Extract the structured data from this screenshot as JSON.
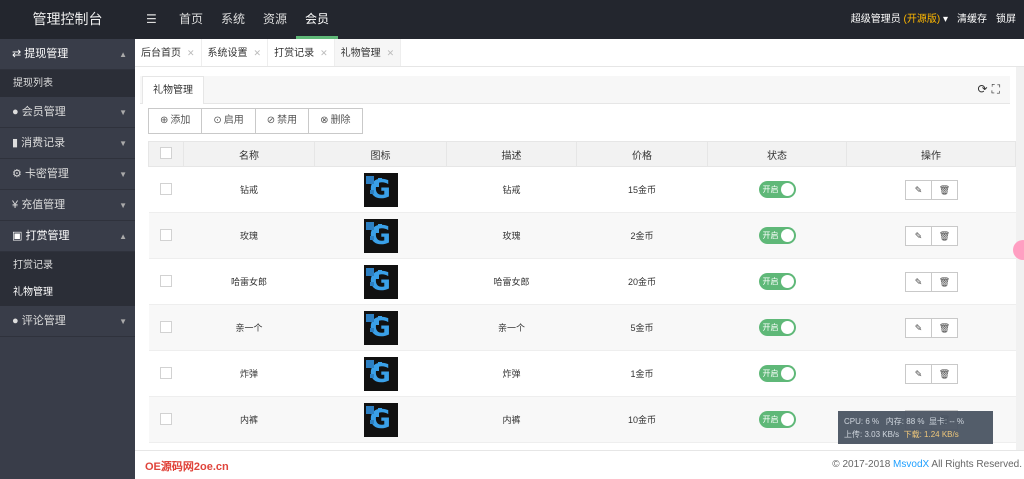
{
  "app": {
    "title": "管理控制台"
  },
  "topnav": {
    "items": [
      "首页",
      "系统",
      "资源",
      "会员"
    ],
    "active_index": 3
  },
  "topright": {
    "user": "超级管理员",
    "edition": "(开源版)",
    "clear_cache": "清缓存",
    "lock": "锁屏"
  },
  "sidebar": {
    "groups": [
      {
        "label": "提现管理",
        "icon": "exchange-icon",
        "open": true,
        "items": [
          "提现列表"
        ]
      },
      {
        "label": "会员管理",
        "icon": "user-icon",
        "open": false,
        "items": []
      },
      {
        "label": "消费记录",
        "icon": "bar-chart-icon",
        "open": false,
        "items": []
      },
      {
        "label": "卡密管理",
        "icon": "gear-icon",
        "open": false,
        "items": []
      },
      {
        "label": "充值管理",
        "icon": "yen-icon",
        "open": false,
        "items": []
      },
      {
        "label": "打赏管理",
        "icon": "money-icon",
        "open": true,
        "items": [
          "打赏记录",
          "礼物管理"
        ]
      },
      {
        "label": "评论管理",
        "icon": "comment-icon",
        "open": false,
        "items": []
      }
    ]
  },
  "tabs": [
    {
      "label": "后台首页"
    },
    {
      "label": "系统设置"
    },
    {
      "label": "打赏记录"
    },
    {
      "label": "礼物管理"
    }
  ],
  "card": {
    "title": "礼物管理"
  },
  "toolbar": {
    "add": "添加",
    "enable": "启用",
    "disable": "禁用",
    "delete": "删除"
  },
  "table": {
    "headers": [
      "名称",
      "图标",
      "描述",
      "价格",
      "状态",
      "操作"
    ],
    "rows": [
      {
        "name": "钻戒",
        "desc": "钻戒",
        "price": "15金币",
        "status": "开启"
      },
      {
        "name": "玫瑰",
        "desc": "玫瑰",
        "price": "2金币",
        "status": "开启"
      },
      {
        "name": "哈雷女郎",
        "desc": "哈雷女郎",
        "price": "20金币",
        "status": "开启"
      },
      {
        "name": "亲一个",
        "desc": "亲一个",
        "price": "5金币",
        "status": "开启"
      },
      {
        "name": "炸弹",
        "desc": "炸弹",
        "price": "1金币",
        "status": "开启"
      },
      {
        "name": "内裤",
        "desc": "内裤",
        "price": "10金币",
        "status": "开启"
      }
    ]
  },
  "footer": {
    "watermark": "OE源码网2oe.cn",
    "copyright_prefix": "© 2017-2018",
    "brand": "MsvodX",
    "copyright_suffix": "All Rights Reserved."
  },
  "monitor": {
    "cpu": "CPU: 6 %",
    "mem": "内存: 88 %",
    "gpu": "显卡: -- %",
    "up": "上传: 3.03 KB/s",
    "down": "下载: 1.24 KB/s"
  },
  "colors": {
    "topbar": "#23262e",
    "sidebar": "#393d49",
    "accent": "#5fb878",
    "brand_link": "#1e9fff"
  }
}
